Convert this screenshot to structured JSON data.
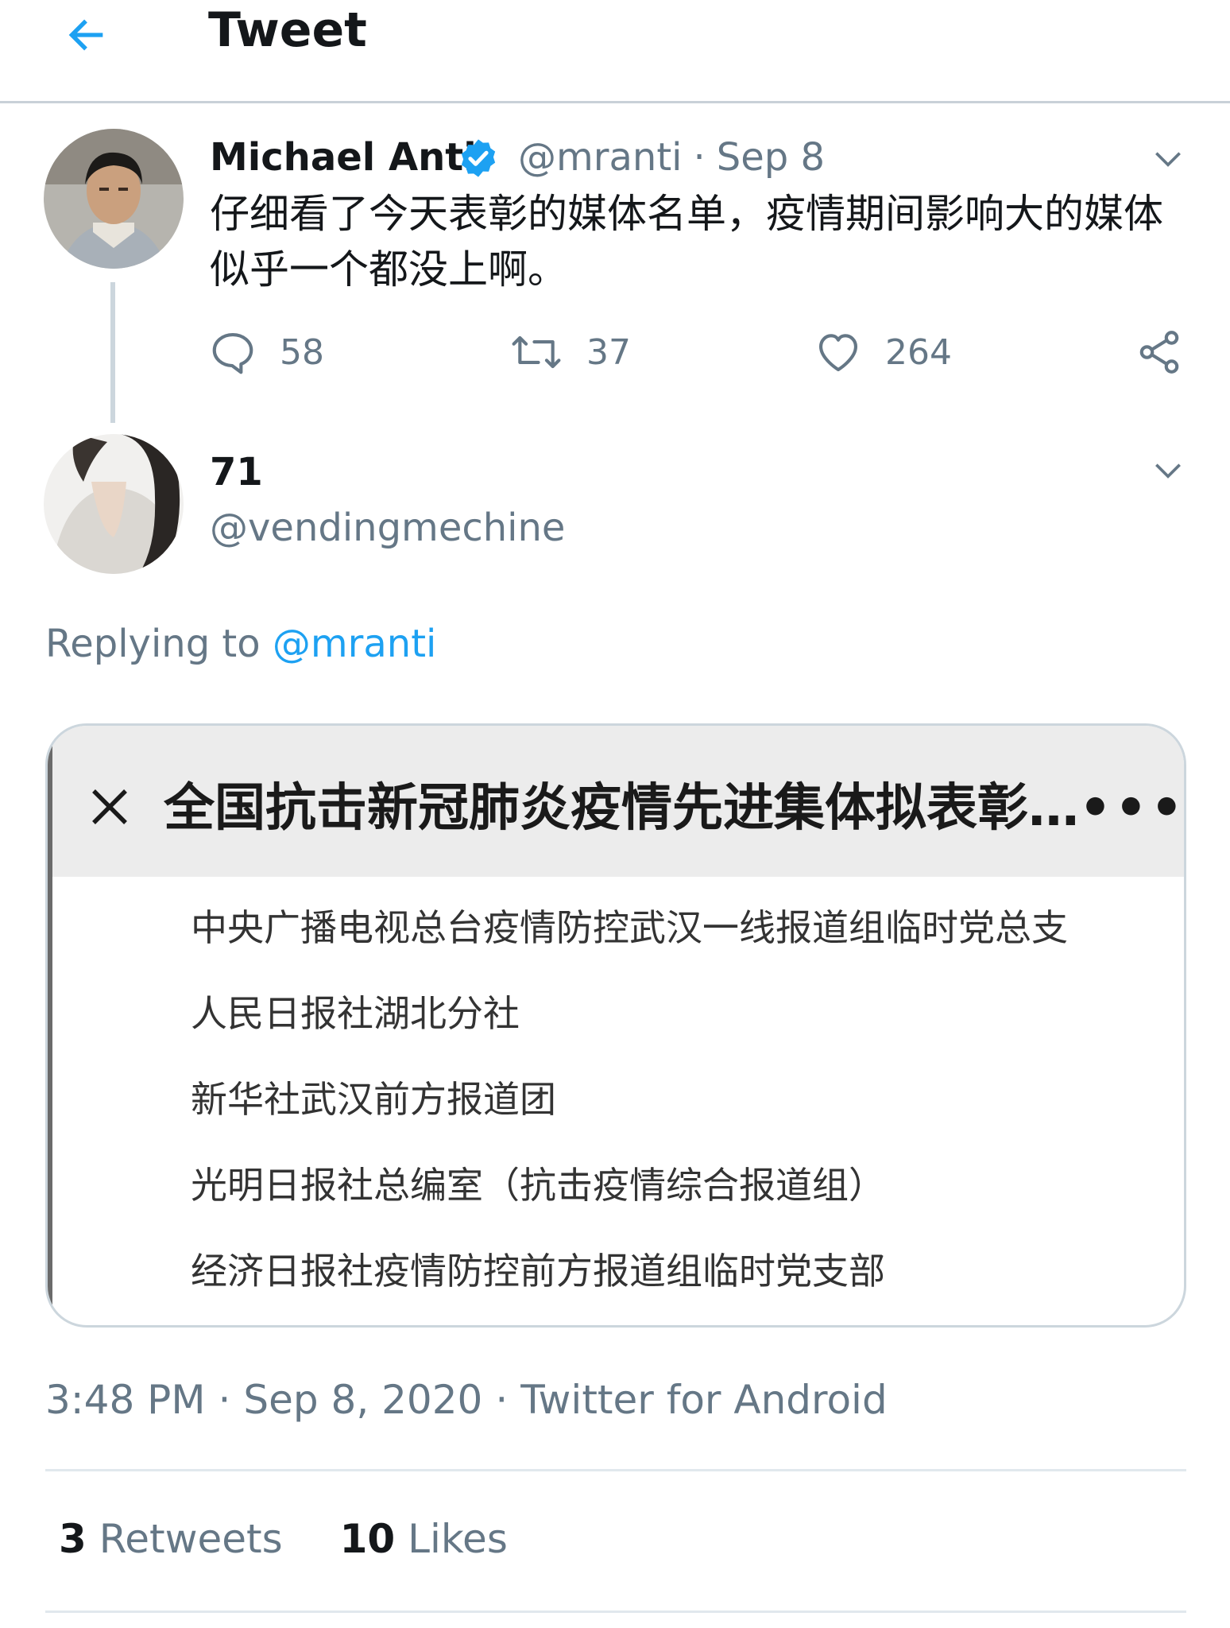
{
  "header": {
    "title": "Tweet",
    "back_icon": "arrow-left-icon",
    "accent": "#1da1f2"
  },
  "tweet": {
    "author_name": "Michael Anti",
    "verified": true,
    "handle": "@mranti",
    "date": "Sep 8",
    "text": "仔细看了今天表彰的媒体名单，疫情期间影响大的媒体似乎一个都没上啊。",
    "replies": "58",
    "retweets": "37",
    "likes": "264"
  },
  "reply": {
    "author_name": "71",
    "handle": "@vendingmechine",
    "replying_prefix": "Replying to",
    "replying_to": "@mranti",
    "image": {
      "title": "全国抗击新冠肺炎疫情先进集体拟表彰…",
      "more": "•••",
      "items": [
        "中央广播电视总台疫情防控武汉一线报道组临时党总支",
        "人民日报社湖北分社",
        "新华社武汉前方报道团",
        "光明日报社总编室（抗击疫情综合报道组）",
        "经济日报社疫情防控前方报道组临时党支部"
      ]
    },
    "time": "3:48 PM",
    "date": "Sep 8, 2020",
    "source": "Twitter for Android",
    "retweet_count": "3",
    "retweet_label": "Retweets",
    "like_count": "10",
    "like_label": "Likes"
  },
  "colors": {
    "text_primary": "#14171a",
    "text_secondary": "#657786",
    "link": "#1da1f2",
    "divider": "#e1e8ed"
  }
}
